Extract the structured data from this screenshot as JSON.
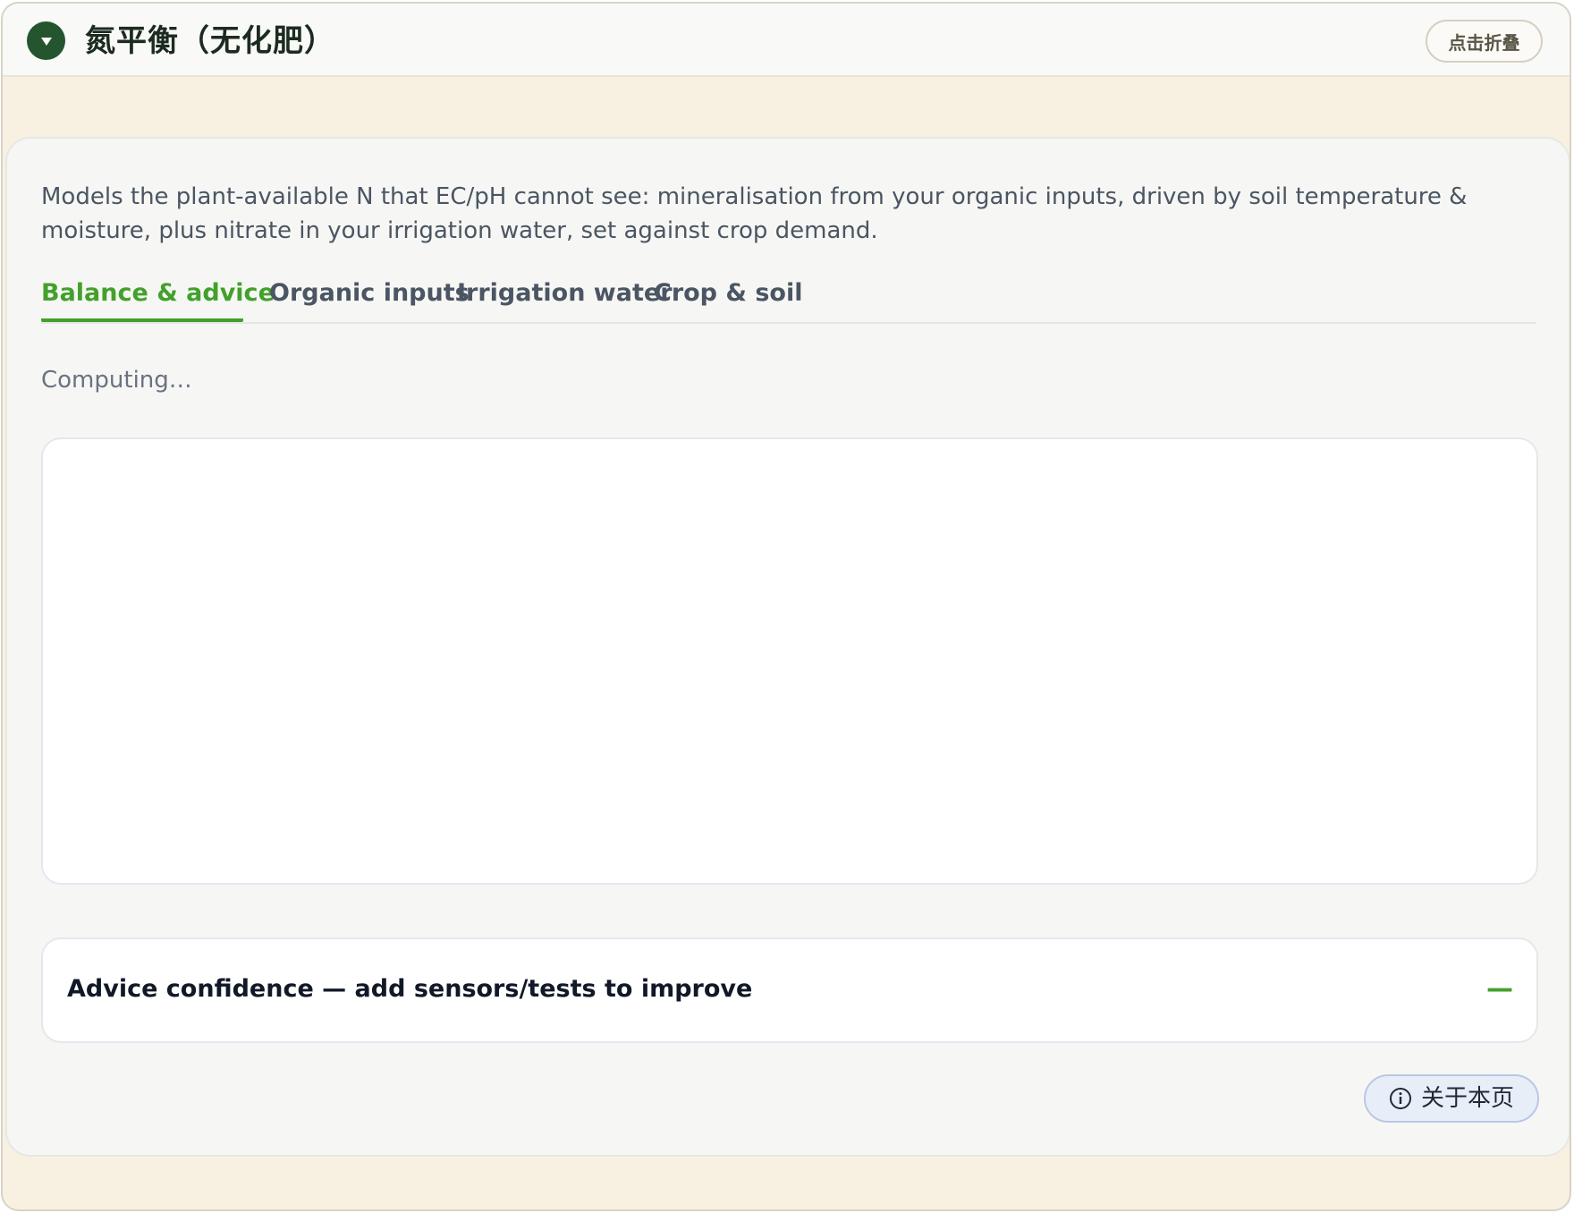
{
  "header": {
    "title": "氮平衡（无化肥）",
    "fold_label": "点击折叠",
    "toggle_icon": "triangle-down-icon"
  },
  "card": {
    "description": "Models the plant-available N that EC/pH cannot see: mineralisation from your organic inputs, driven by soil temperature & moisture, plus nitrate in your irrigation water, set against crop demand.",
    "tabs": [
      {
        "label": "Balance & advice",
        "active": true
      },
      {
        "label": "Organic inputs",
        "active": false
      },
      {
        "label": "Irrigation water",
        "active": false
      },
      {
        "label": "Crop & soil",
        "active": false
      }
    ],
    "status": "Computing…",
    "confidence": {
      "title": "Advice confidence — add sensors/tests to improve",
      "value": "—"
    },
    "about_label": "关于本页",
    "about_icon": "info-icon"
  },
  "colors": {
    "accent": "#43a02c",
    "header_toggle": "#24552f",
    "page_background": "#f8f1e1",
    "card_background": "#f6f7f4"
  }
}
